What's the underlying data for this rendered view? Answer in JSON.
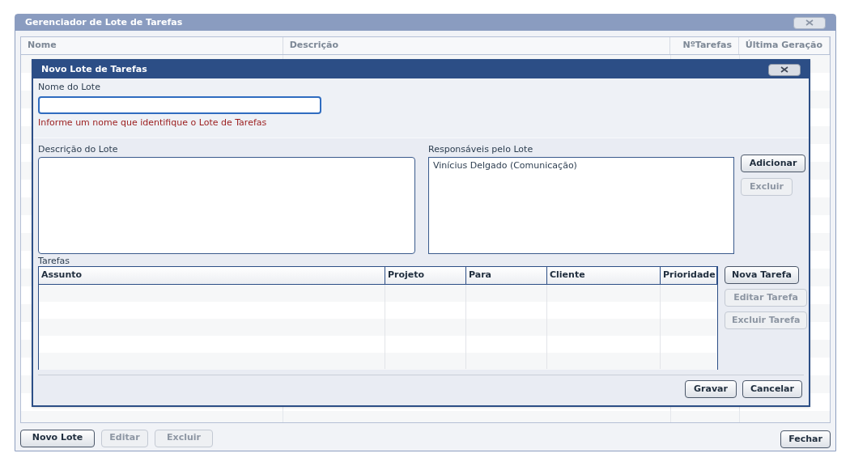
{
  "window": {
    "title": "Gerenciador de Lote de Tarefas"
  },
  "lotes_table": {
    "columns": [
      "Nome",
      "Descrição",
      "NºTarefas",
      "Última Geração"
    ]
  },
  "buttons": [
    {
      "label": "Novo Lote",
      "disabled": false
    },
    {
      "label": "Editar",
      "disabled": true
    },
    {
      "label": "Excluir",
      "disabled": true
    }
  ],
  "close_button": {
    "label": "Fechar",
    "disabled": false
  },
  "dialog": {
    "title": "Novo Lote de Tarefas",
    "name_field": {
      "label": "Nome do Lote",
      "hint": "Informe um nome que identifique o Lote de Tarefas"
    },
    "description_field": {
      "label": "Descrição do Lote"
    },
    "responsaveis": {
      "label": "Responsáveis pelo Lote",
      "items": [
        "Vinícius Delgado (Comunicação)"
      ],
      "buttons": [
        {
          "label": "Adicionar",
          "disabled": false
        },
        {
          "label": "Excluir",
          "disabled": true
        }
      ]
    },
    "tarefas": {
      "label": "Tarefas",
      "columns": [
        "Assunto",
        "Projeto",
        "Para",
        "Cliente",
        "Prioridade"
      ],
      "buttons": [
        {
          "label": "Nova Tarefa",
          "disabled": false
        },
        {
          "label": "Editar Tarefa",
          "disabled": true
        },
        {
          "label": "Excluir Tarefa",
          "disabled": true
        }
      ]
    },
    "footer_buttons": [
      {
        "label": "Gravar",
        "disabled": false
      },
      {
        "label": "Cancelar",
        "disabled": false
      }
    ]
  }
}
